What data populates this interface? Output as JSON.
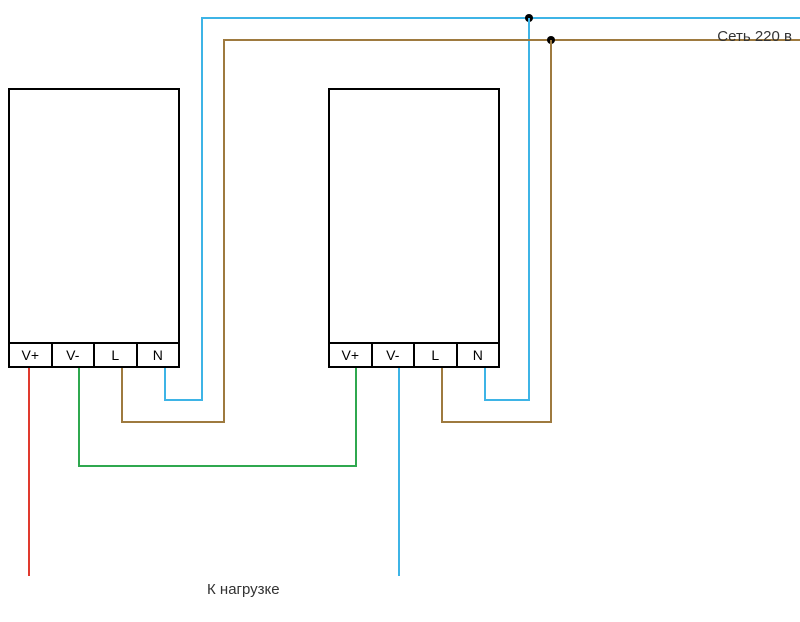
{
  "labels": {
    "mains": "Сеть 220 в",
    "load": "К нагрузке"
  },
  "devices": [
    {
      "id": "device-1",
      "terminals": [
        "V+",
        "V-",
        "L",
        "N"
      ]
    },
    {
      "id": "device-2",
      "terminals": [
        "V+",
        "V-",
        "L",
        "N"
      ]
    }
  ],
  "wiring": {
    "description": "Two power supply units wired to 220V mains (L=brown, N=blue). V- of unit 1 connected to V+ of unit 2 (green, series). V+ of unit 1 (red) and V- of unit 2 (blue) go to load.",
    "colors": {
      "neutral": "#3eb4e6",
      "line": "#9e7a3f",
      "series_link": "#2fa84f",
      "load_pos": "#e03a2e",
      "load_neg": "#3eb4e6"
    }
  }
}
